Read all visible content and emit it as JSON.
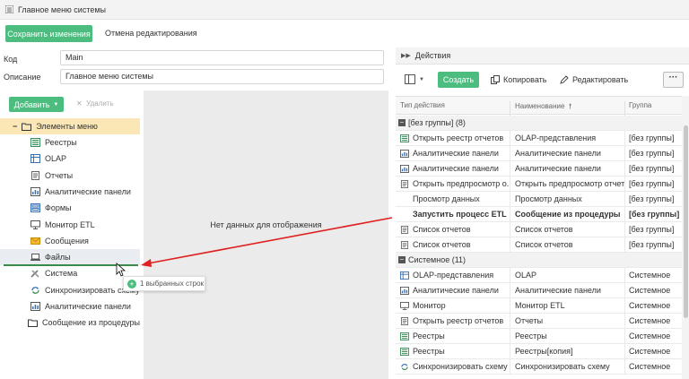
{
  "window": {
    "title": "Главное меню системы"
  },
  "toolbar": {
    "save_label": "Сохранить изменения",
    "cancel_label": "Отмена редактирования"
  },
  "form": {
    "code_label": "Код",
    "code_value": "Main",
    "desc_label": "Описание",
    "desc_value": "Главное меню системы"
  },
  "tree_toolbar": {
    "add_label": "Добавить",
    "delete_label": "Удалить"
  },
  "tree": {
    "root_label": "Элементы меню",
    "items": [
      {
        "label": "Реестры",
        "icon": "registry-icon"
      },
      {
        "label": "OLAP",
        "icon": "olap-icon"
      },
      {
        "label": "Отчеты",
        "icon": "report-icon"
      },
      {
        "label": "Аналитические панели",
        "icon": "dashboard-icon"
      },
      {
        "label": "Формы",
        "icon": "form-icon"
      },
      {
        "label": "Монитор ETL",
        "icon": "monitor-icon"
      },
      {
        "label": "Сообщения",
        "icon": "mail-icon"
      },
      {
        "label": "Файлы",
        "icon": "laptop-icon"
      },
      {
        "label": "Система",
        "icon": "tools-icon"
      },
      {
        "label": "Синхронизировать схему",
        "icon": "sync-icon"
      },
      {
        "label": "Аналитические панели",
        "icon": "dashboard-icon"
      },
      {
        "label": "Сообщение из процедуры",
        "icon": "folder-icon"
      }
    ]
  },
  "middle": {
    "empty_text": "Нет данных для отображения"
  },
  "drag_tooltip": {
    "text": "1 выбранных строк"
  },
  "actions_panel": {
    "title": "Действия",
    "create_label": "Создать",
    "copy_label": "Копировать",
    "edit_label": "Редактировать",
    "more_label": "···"
  },
  "grid": {
    "columns": [
      "Тип действия",
      "Наименование",
      "Группа"
    ],
    "groups": [
      {
        "label": "[без группы] (8)",
        "rows": [
          {
            "type": "Открыть реестр отчетов",
            "name": "OLAP-представления",
            "group": "[без группы]",
            "icon": "registry-icon"
          },
          {
            "type": "Аналитические панели",
            "name": "Аналитические панели",
            "group": "[без группы]",
            "icon": "dashboard-icon"
          },
          {
            "type": "Аналитические панели",
            "name": "Аналитические панели",
            "group": "[без группы]",
            "icon": "dashboard-icon"
          },
          {
            "type": "Открыть предпросмотр о...",
            "name": "Открыть предпросмотр отчета",
            "group": "[без группы]",
            "icon": "report-icon"
          },
          {
            "type": "Просмотр данных",
            "name": "Просмотр данных",
            "group": "[без группы]",
            "icon": ""
          },
          {
            "type": "Запустить процесс ETL",
            "name": "Сообщение из процедуры",
            "group": "[без группы]",
            "icon": "",
            "bold": true
          },
          {
            "type": "Список отчетов",
            "name": "Список отчетов",
            "group": "[без группы]",
            "icon": "report-icon"
          },
          {
            "type": "Список отчетов",
            "name": "Список отчетов",
            "group": "[без группы]",
            "icon": "report-icon"
          }
        ]
      },
      {
        "label": "Системное (11)",
        "rows": [
          {
            "type": "OLAP-представления",
            "name": "OLAP",
            "group": "Системное",
            "icon": "olap-icon"
          },
          {
            "type": "Аналитические панели",
            "name": "Аналитические панели",
            "group": "Системное",
            "icon": "dashboard-icon"
          },
          {
            "type": "Монитор",
            "name": "Монитор ETL",
            "group": "Системное",
            "icon": "monitor-icon"
          },
          {
            "type": "Открыть реестр отчетов",
            "name": "Отчеты",
            "group": "Системное",
            "icon": "report-icon"
          },
          {
            "type": "Реестры",
            "name": "Реестры",
            "group": "Системное",
            "icon": "registry-icon"
          },
          {
            "type": "Реестры",
            "name": "Реестры[копия]",
            "group": "Системное",
            "icon": "registry-icon"
          },
          {
            "type": "Синхронизировать схему",
            "name": "Синхронизировать схему",
            "group": "Системное",
            "icon": "sync-icon"
          }
        ]
      }
    ]
  },
  "colors": {
    "accent": "#4cbc7f",
    "selection": "#fbe7b5",
    "arrow": "#e02020"
  }
}
